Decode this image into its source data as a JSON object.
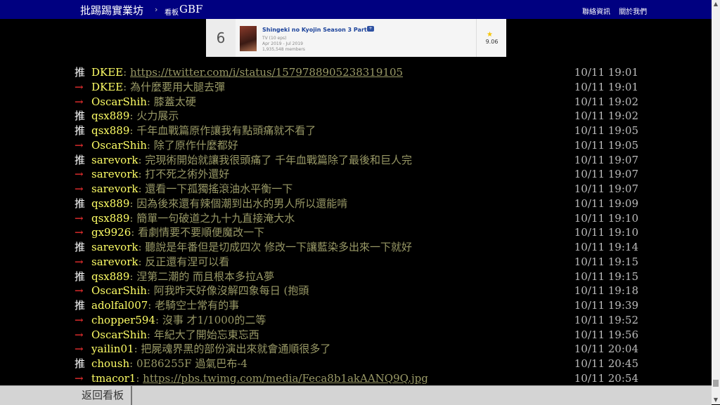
{
  "header": {
    "brand": "批踢踢實業坊",
    "separator": "›",
    "board_label": "看板",
    "board_name": "GBF",
    "links": [
      "聯絡資訊",
      "關於我們"
    ]
  },
  "embed": {
    "rank": "6",
    "title": "Shingeki no Kyojin Season 3 Part 2",
    "type": "TV (10 eps)",
    "aired": "Apr 2019 - Jul 2019",
    "members": "1,935,548 members",
    "score": "9.06",
    "star_color": "#f6c500"
  },
  "pushes": [
    {
      "tag": "推",
      "user": "DKEE",
      "content": "https://twitter.com/i/status/1579788905238319105",
      "time": "10/11 19:01",
      "link": true
    },
    {
      "tag": "→",
      "user": "DKEE",
      "content": "為什麼要用大腿去彈",
      "time": "10/11 19:01"
    },
    {
      "tag": "→",
      "user": "OscarShih",
      "content": "膝蓋太硬",
      "time": "10/11 19:02"
    },
    {
      "tag": "推",
      "user": "qsx889",
      "content": "火力展示",
      "time": "10/11 19:02"
    },
    {
      "tag": "推",
      "user": "qsx889",
      "content": "千年血戰篇原作讓我有點頭痛就不看了",
      "time": "10/11 19:05"
    },
    {
      "tag": "→",
      "user": "OscarShih",
      "content": "除了原作什麼都好",
      "time": "10/11 19:05"
    },
    {
      "tag": "推",
      "user": "sarevork",
      "content": "完現術開始就讓我很頭痛了 千年血戰篇除了最後和巨人完",
      "time": "10/11 19:07"
    },
    {
      "tag": "→",
      "user": "sarevork",
      "content": "打不死之術外還好",
      "time": "10/11 19:07"
    },
    {
      "tag": "→",
      "user": "sarevork",
      "content": "還看一下孤獨搖滾油水平衡一下",
      "time": "10/11 19:07"
    },
    {
      "tag": "推",
      "user": "qsx889",
      "content": "因為後來還有辣個潮到出水的男人所以還能啃",
      "time": "10/11 19:09"
    },
    {
      "tag": "→",
      "user": "qsx889",
      "content": "簡單一句破道之九十九直接淹大水",
      "time": "10/11 19:10"
    },
    {
      "tag": "→",
      "user": "gx9926",
      "content": "看劇情要不要順便魔改一下",
      "time": "10/11 19:10"
    },
    {
      "tag": "推",
      "user": "sarevork",
      "content": "聽說是年番但是切成四次 修改一下讓藍染多出來一下就好",
      "time": "10/11 19:14"
    },
    {
      "tag": "→",
      "user": "sarevork",
      "content": "反正還有涅可以看",
      "time": "10/11 19:15"
    },
    {
      "tag": "推",
      "user": "qsx889",
      "content": "涅第二潮的 而且根本多拉A夢",
      "time": "10/11 19:15"
    },
    {
      "tag": "→",
      "user": "OscarShih",
      "content": "阿我昨天好像沒解四象每日 (抱頭",
      "time": "10/11 19:18"
    },
    {
      "tag": "推",
      "user": "adolfal007",
      "content": "老騎空士常有的事",
      "time": "10/11 19:39"
    },
    {
      "tag": "→",
      "user": "chopper594",
      "content": "沒事 才1/1000的二等",
      "time": "10/11 19:52"
    },
    {
      "tag": "→",
      "user": "OscarShih",
      "content": "年紀大了開始忘東忘西",
      "time": "10/11 19:56"
    },
    {
      "tag": "→",
      "user": "yailin01",
      "content": "把屍魂界黑的部份演出來就會通順很多了",
      "time": "10/11 20:04"
    },
    {
      "tag": "推",
      "user": "choush",
      "content": "0E86255F 過氣巴布-4",
      "time": "10/11 20:45"
    },
    {
      "tag": "→",
      "user": "tmacor1",
      "content": "https://pbs.twimg.com/media/Feca8b1akAANQ9Q.jpg",
      "time": "10/11 20:54",
      "link": true
    }
  ],
  "footer": {
    "back_label": "返回看板"
  },
  "colors": {
    "header_bg": "#000080",
    "push_user": "#ff6",
    "push_content": "#996",
    "arrow_tag": "#f33"
  }
}
